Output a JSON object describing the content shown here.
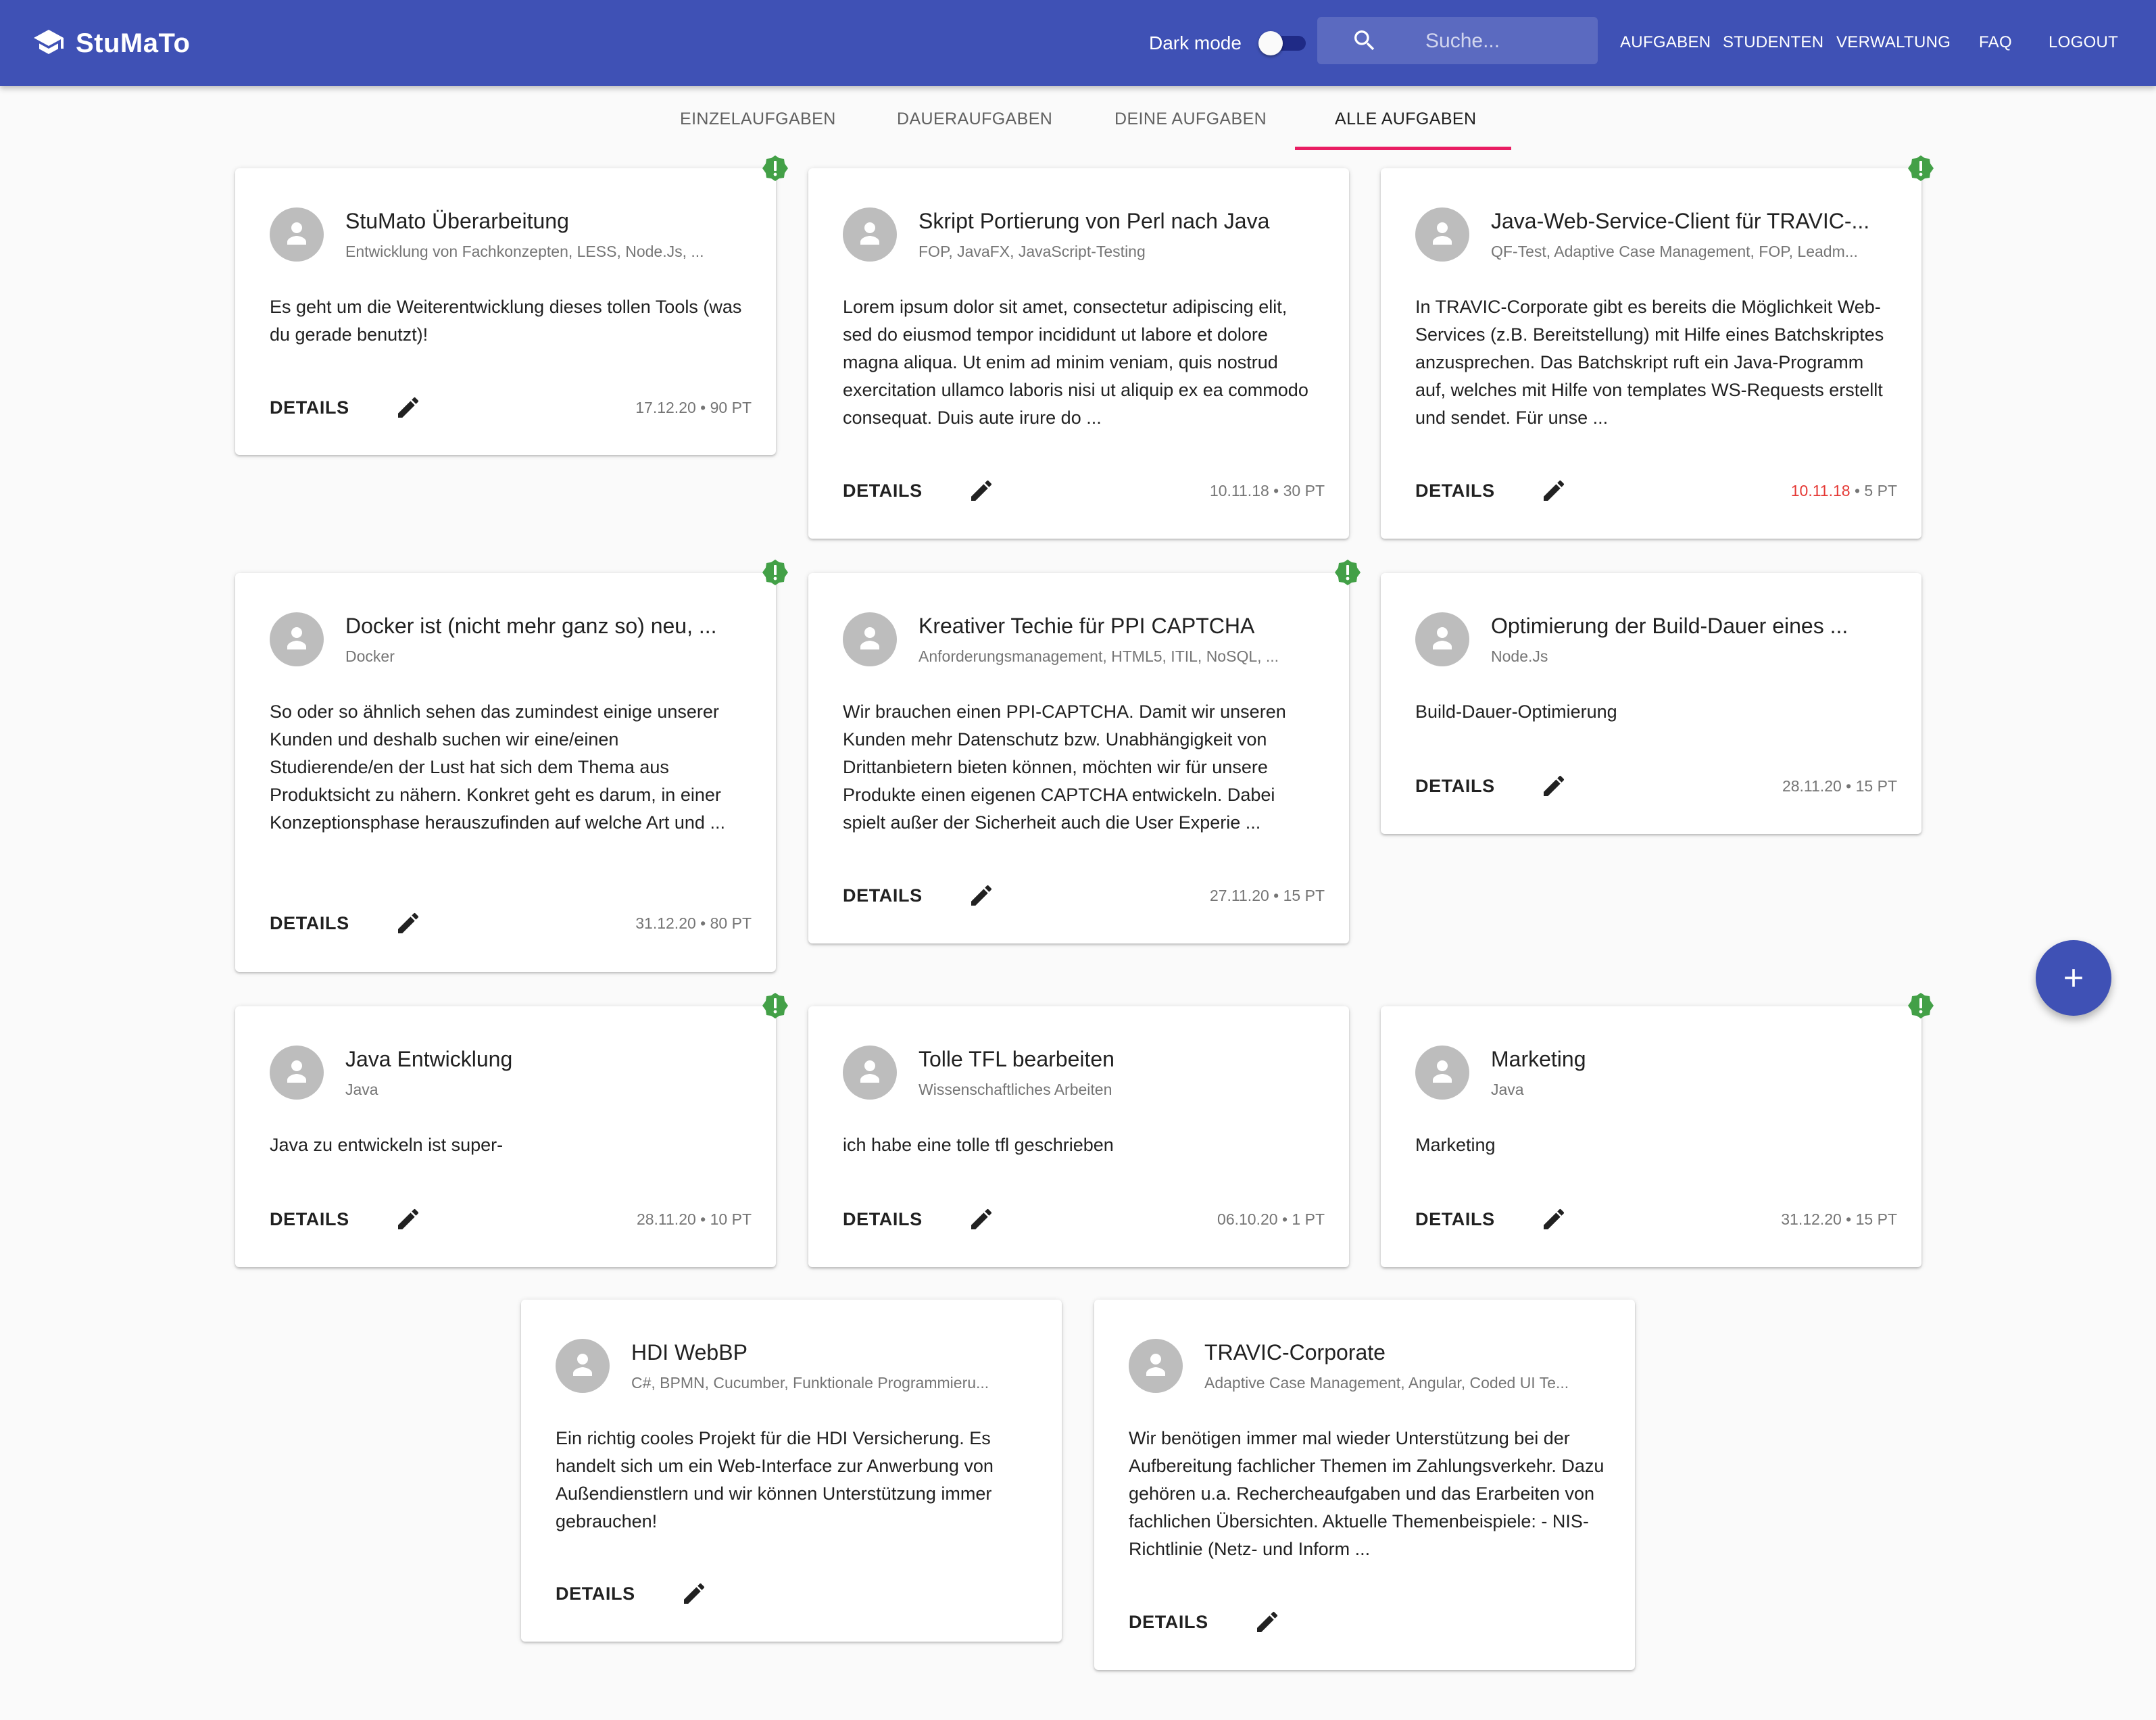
{
  "app": {
    "title": "StuMaTo"
  },
  "header": {
    "dark_mode_label": "Dark mode",
    "search_placeholder": "Suche...",
    "nav": [
      "AUFGABEN",
      "STUDENTEN",
      "VERWALTUNG",
      "FAQ",
      "LOGOUT"
    ]
  },
  "tabs": [
    {
      "label": "EINZELAUFGABEN"
    },
    {
      "label": "DAUERAUFGABEN"
    },
    {
      "label": "DEINE AUFGABEN"
    },
    {
      "label": "ALLE AUFGABEN",
      "active": true
    }
  ],
  "details_label": "DETAILS",
  "cards": [
    {
      "title": "StuMato Überarbeitung",
      "tags": "Entwicklung von Fachkonzepten, LESS, Node.Js, ...",
      "text": "Es geht um die Weiterentwicklung dieses tollen Tools (was du gerade benutzt)!",
      "date": "17.12.20",
      "points": "90 PT",
      "flag": true
    },
    {
      "title": "Skript Portierung von Perl nach Java",
      "tags": "FOP, JavaFX, JavaScript-Testing",
      "text": "Lorem ipsum dolor sit amet, consectetur adipiscing elit, sed do eiusmod tempor incididunt ut labore et dolore magna aliqua. Ut enim ad minim veniam, quis nostrud exercitation ullamco laboris nisi ut aliquip ex ea commodo consequat. Duis aute irure do ...",
      "date": "10.11.18",
      "points": "30 PT",
      "flag": false
    },
    {
      "title": "Java-Web-Service-Client für TRAVIC-...",
      "tags": "QF-Test, Adaptive Case Management, FOP, Leadm...",
      "text": "In TRAVIC-Corporate gibt es bereits die Möglichkeit Web-Services (z.B. Bereitstellung) mit Hilfe eines Batchskriptes anzusprechen. Das Batchskript ruft ein Java-Programm auf, welches mit Hilfe von templates WS-Requests erstellt und sendet. Für unse ...",
      "date": "10.11.18",
      "points": "5 PT",
      "flag": true,
      "overdue": true
    },
    {
      "title": "Docker ist (nicht mehr ganz so) neu, ...",
      "tags": "Docker",
      "text": "So oder so ähnlich sehen das zumindest einige unserer Kunden und deshalb suchen wir eine/einen Studierende/en der Lust hat sich dem Thema aus Produktsicht zu nähern. Konkret geht es darum, in einer Konzeptionsphase herauszufinden auf welche Art und ...",
      "date": "31.12.20",
      "points": "80 PT",
      "flag": true
    },
    {
      "title": "Kreativer Techie für PPI CAPTCHA",
      "tags": "Anforderungsmanagement, HTML5, ITIL, NoSQL, ...",
      "text": "Wir brauchen einen PPI-CAPTCHA. Damit wir unseren Kunden mehr Datenschutz bzw. Unabhängigkeit von Drittanbietern bieten können, möchten wir für unsere Produkte einen eigenen CAPTCHA entwickeln. Dabei spielt außer der Sicherheit auch die User Experie ...",
      "date": "27.11.20",
      "points": "15 PT",
      "flag": true
    },
    {
      "title": "Optimierung der Build-Dauer eines ...",
      "tags": "Node.Js",
      "text": "Build-Dauer-Optimierung",
      "date": "28.11.20",
      "points": "15 PT",
      "flag": false
    },
    {
      "title": "Java Entwicklung",
      "tags": "Java",
      "text": "Java zu entwickeln ist super-",
      "date": "28.11.20",
      "points": "10 PT",
      "flag": true
    },
    {
      "title": "Tolle TFL bearbeiten",
      "tags": "Wissenschaftliches Arbeiten",
      "text": "ich habe eine tolle tfl geschrieben",
      "date": "06.10.20",
      "points": "1 PT",
      "flag": false
    },
    {
      "title": "Marketing",
      "tags": "Java",
      "text": "Marketing",
      "date": "31.12.20",
      "points": "15 PT",
      "flag": true
    },
    {
      "title": "HDI WebBP",
      "tags": "C#, BPMN, Cucumber, Funktionale Programmieru...",
      "text": "Ein richtig cooles Projekt für die HDI Versicherung. Es handelt sich um ein Web-Interface zur Anwerbung von Außendienstlern und wir können Unterstützung immer gebrauchen!",
      "date": "",
      "points": "",
      "flag": false
    },
    {
      "title": "TRAVIC-Corporate",
      "tags": "Adaptive Case Management, Angular, Coded UI Te...",
      "text": "Wir benötigen immer mal wieder Unterstützung bei der Aufbereitung fachlicher Themen im Zahlungsverkehr. Dazu gehören u.a. Rechercheaufgaben und das Erarbeiten von fachlichen Übersichten. Aktuelle Themenbeispiele: - NIS-Richtlinie (Netz- und Inform ...",
      "date": "",
      "points": "",
      "flag": false
    }
  ],
  "colors": {
    "primary": "#3f51b5",
    "tab_indicator": "#e91e63",
    "badge": "#43a047",
    "overdue": "#e53935"
  },
  "icons": {
    "brand": "school-icon",
    "search": "search-icon",
    "avatar": "person-icon",
    "edit": "pencil-icon",
    "badge": "priority-icon",
    "fab": "plus-icon"
  }
}
